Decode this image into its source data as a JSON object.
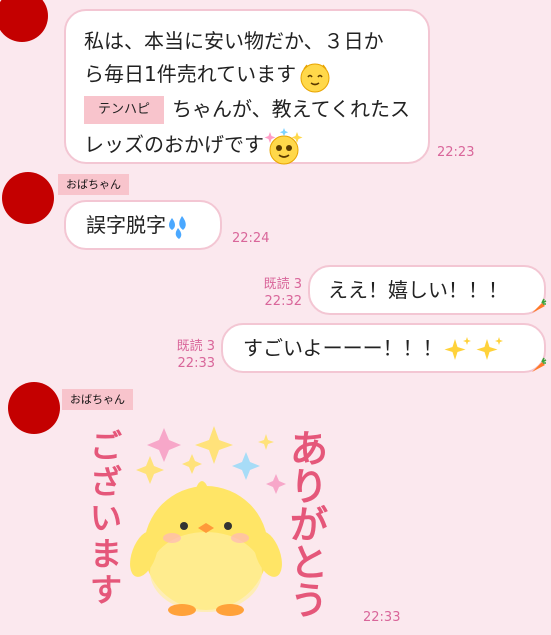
{
  "messages": {
    "m1": {
      "line1": "私は、本当に安い物だか、３日か",
      "line2": "ら毎日1件売れています",
      "tag": "テンハピ",
      "line3": "ちゃんが、教えてくれたス",
      "line4": "レッズのおかげです",
      "time": "22:23"
    },
    "m2": {
      "sender": "おばちゃん",
      "text": "誤字脱字",
      "time": "22:24"
    },
    "m3": {
      "read": "既読 3",
      "time": "22:32",
      "text": "ええ！嬉しい！！！"
    },
    "m4": {
      "read": "既読 3",
      "time": "22:33",
      "text": "すごいよーーー！！！"
    },
    "m5": {
      "sender": "おばちゃん",
      "sticker_text_right": "ありがとう",
      "sticker_text_left": "ございます",
      "time": "22:33"
    }
  },
  "icons": [
    "smile-emoji-icon",
    "sparkle-face-emoji-icon",
    "sweat-drops-icon",
    "sparkles-icon",
    "carrot-icon",
    "chick-sticker"
  ],
  "colors": {
    "background": "#fbe8ee",
    "avatar": "#c40000",
    "badge": "#f8c4cc",
    "timestamp": "#d9669a",
    "bubble_border": "#f3c6d3"
  }
}
